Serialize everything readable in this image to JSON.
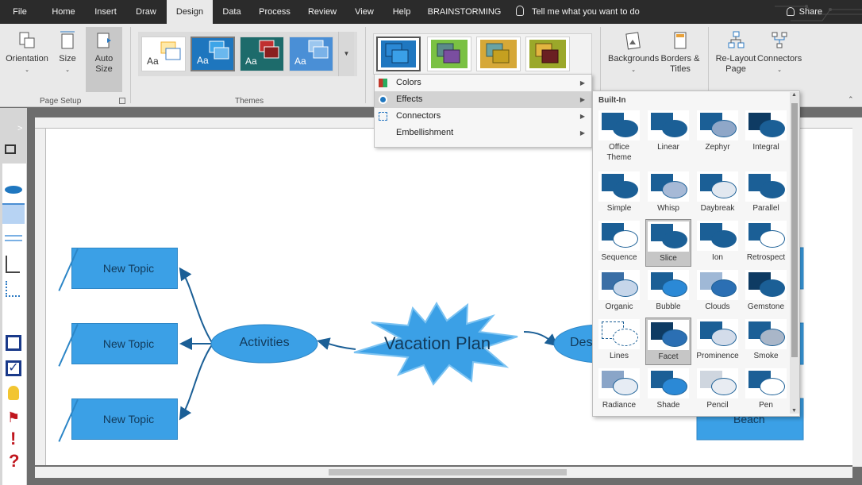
{
  "menubar": {
    "tabs": [
      "File",
      "Home",
      "Insert",
      "Draw",
      "Design",
      "Data",
      "Process",
      "Review",
      "View",
      "Help",
      "BRAINSTORMING"
    ],
    "active_tab": "Design",
    "tell_me": "Tell me what you want to do",
    "share": "Share"
  },
  "ribbon": {
    "page_setup": {
      "orientation": "Orientation",
      "size": "Size",
      "auto_size": "Auto Size",
      "group_label": "Page Setup"
    },
    "themes": {
      "group_label": "Themes",
      "thumb_text": "Aa"
    },
    "backgrounds": "Backgrounds",
    "borders_titles": "Borders & Titles",
    "relayout_page": "Re-Layout Page",
    "connectors": "Connectors"
  },
  "variant_menu": {
    "items": [
      "Colors",
      "Effects",
      "Connectors",
      "Embellishment"
    ],
    "highlighted": "Effects"
  },
  "effects_panel": {
    "title": "Built-In",
    "selected": [
      "Slice",
      "Facet"
    ],
    "items": [
      "Office Theme",
      "Linear",
      "Zephyr",
      "Integral",
      "Simple",
      "Whisp",
      "Daybreak",
      "Parallel",
      "Sequence",
      "Slice",
      "Ion",
      "Retrospect",
      "Organic",
      "Bubble",
      "Clouds",
      "Gemstone",
      "Lines",
      "Facet",
      "Prominence",
      "Smoke",
      "Radiance",
      "Shade",
      "Pencil",
      "Pen"
    ]
  },
  "diagram": {
    "topics": [
      "New Topic",
      "New Topic",
      "New Topic"
    ],
    "activities": "Activities",
    "center": "Vacation Plan",
    "partial_right": "Des",
    "partial_beach": "Beach"
  },
  "colors": {
    "accent_blue": "#3ba0e6",
    "dark_blue": "#1b5f96",
    "menubar_bg": "#2b2b2b",
    "ribbon_bg": "#e9e9e9"
  }
}
